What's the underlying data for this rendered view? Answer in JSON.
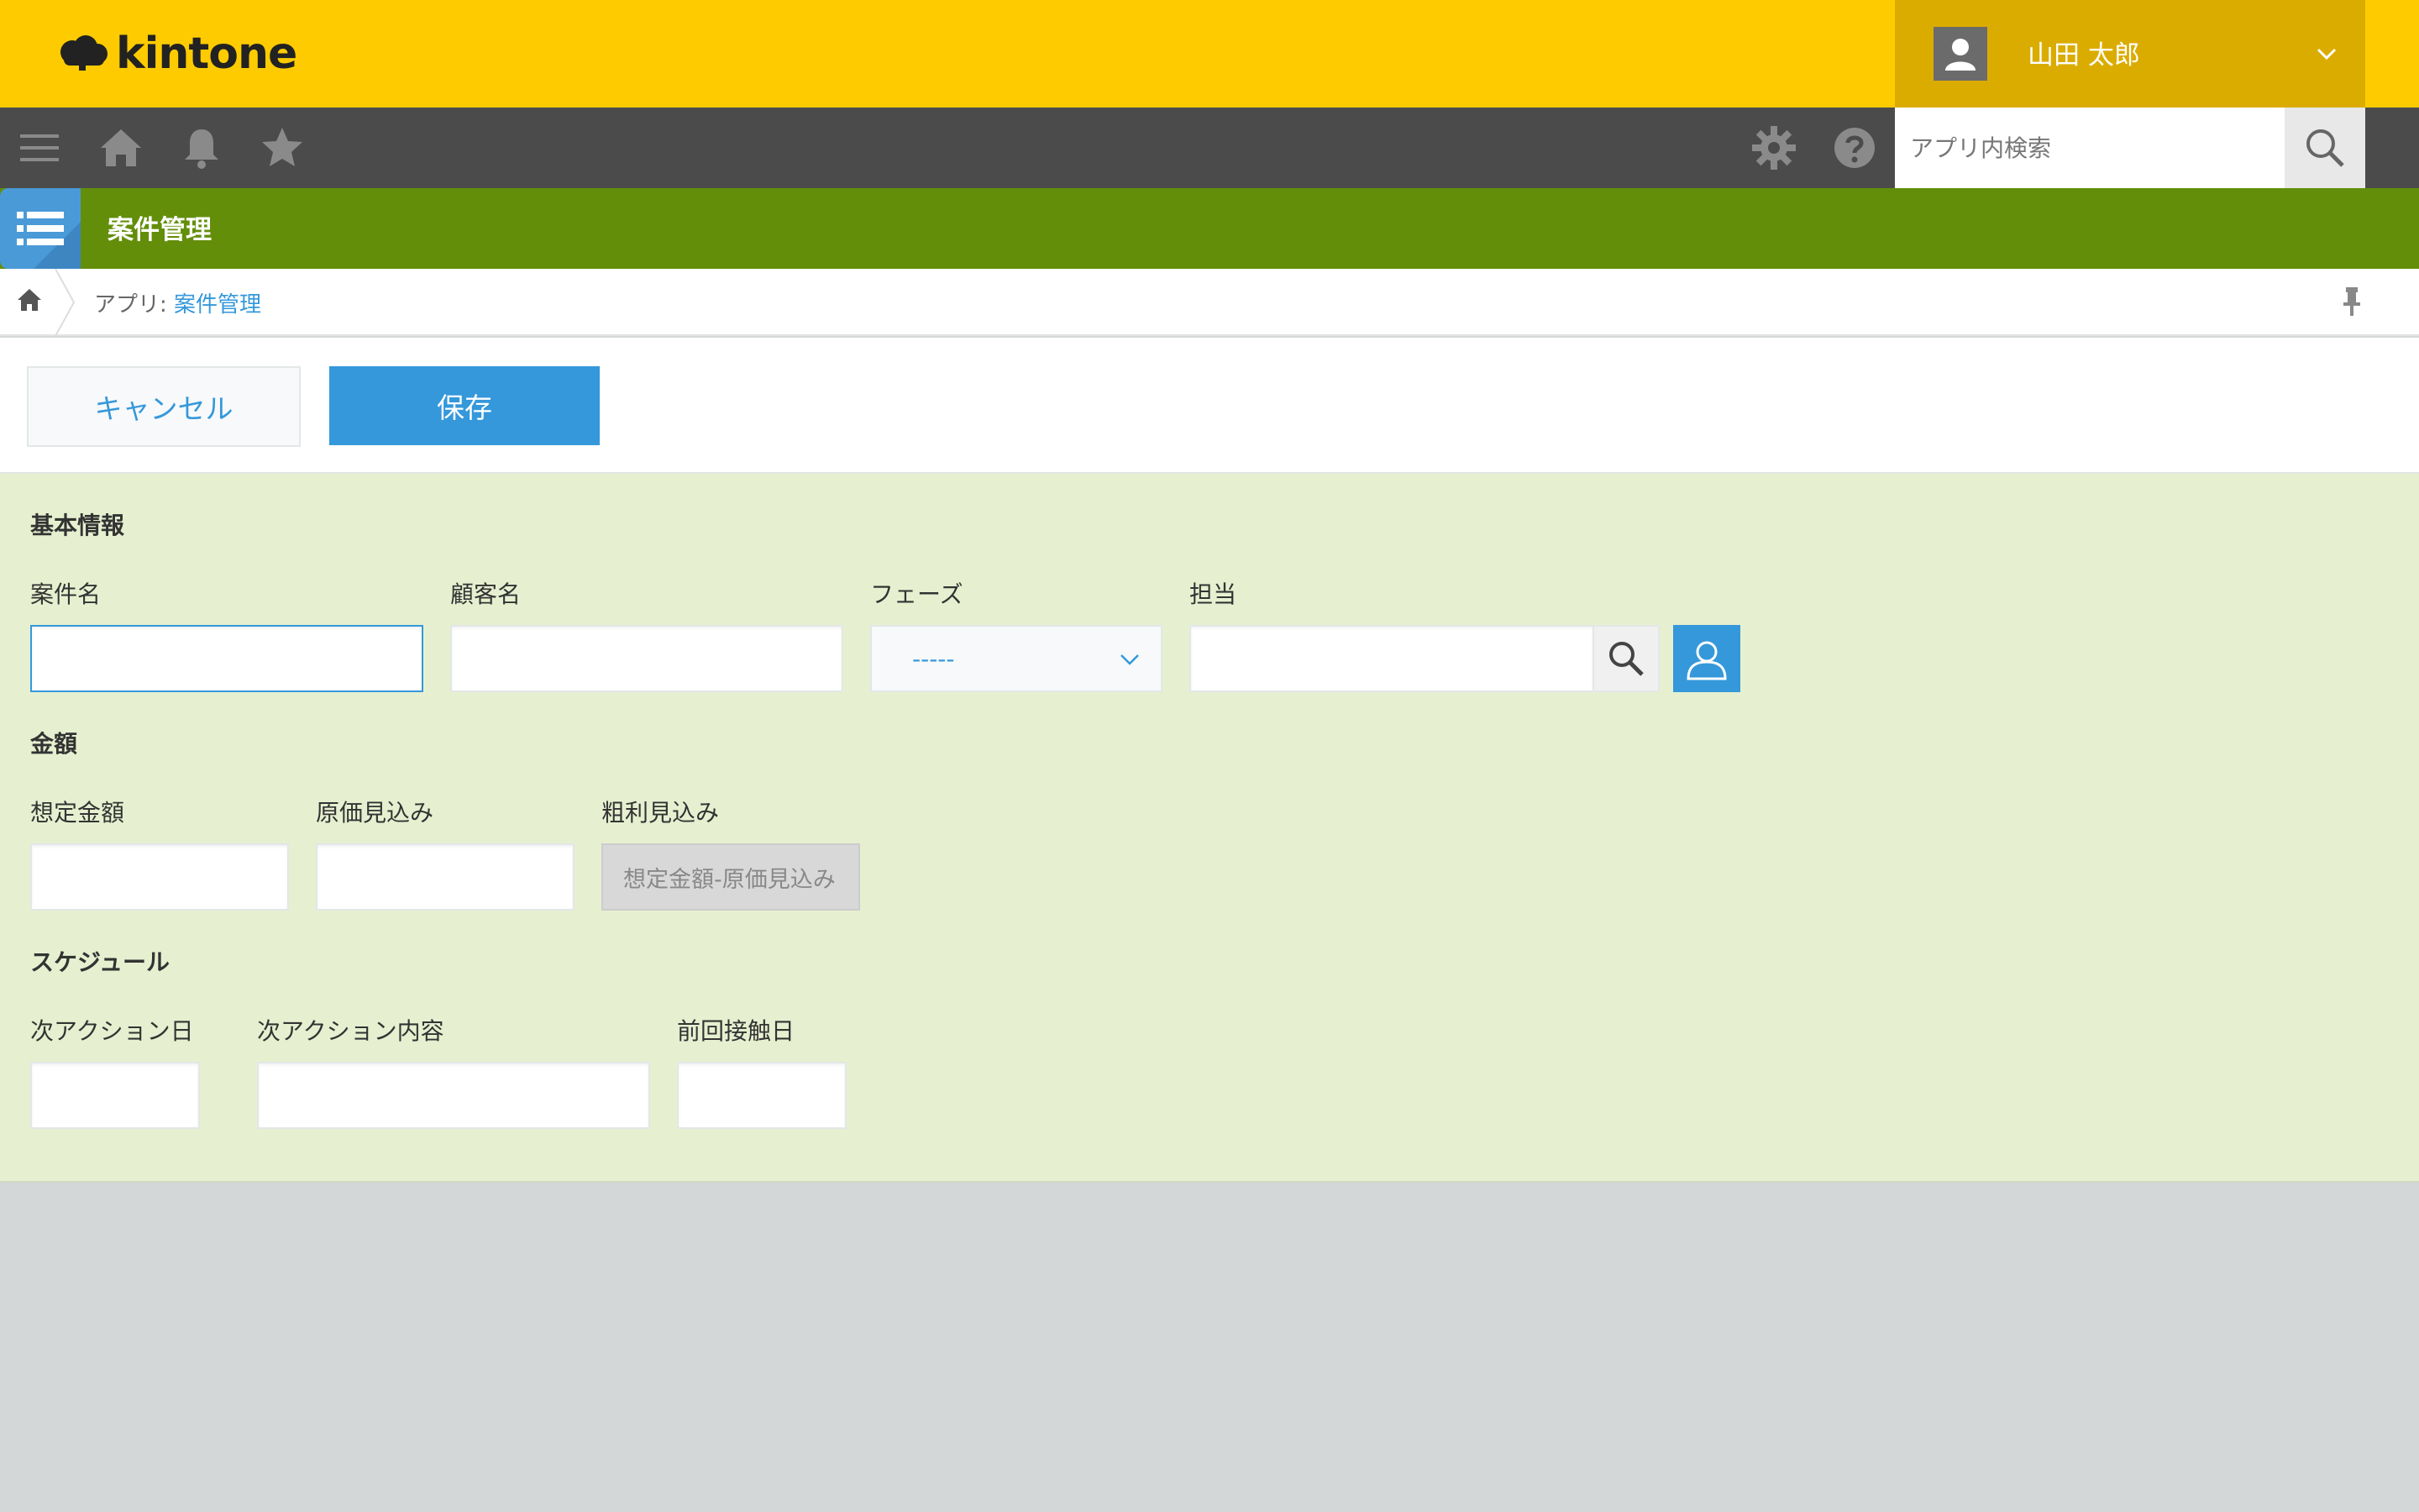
{
  "header": {
    "logo_text": "kintone",
    "user": {
      "name": "山田 太郎"
    }
  },
  "nav": {
    "icons": [
      "menu-icon",
      "home-icon",
      "bell-icon",
      "star-icon",
      "gear-icon",
      "help-icon"
    ],
    "search": {
      "placeholder": "アプリ内検索",
      "value": ""
    }
  },
  "app": {
    "title": "案件管理",
    "accent": "#638e0a"
  },
  "breadcrumb": {
    "prefix": "アプリ: ",
    "app_link": "案件管理"
  },
  "toolbar": {
    "cancel_label": "キャンセル",
    "save_label": "保存"
  },
  "form": {
    "sections": {
      "basic": "基本情報",
      "amount": "金額",
      "schedule": "スケジュール"
    },
    "fields": {
      "deal_name": {
        "label": "案件名",
        "value": ""
      },
      "customer_name": {
        "label": "顧客名",
        "value": ""
      },
      "phase": {
        "label": "フェーズ",
        "value": "-----"
      },
      "owner": {
        "label": "担当",
        "value": ""
      },
      "expected_amount": {
        "label": "想定金額",
        "value": ""
      },
      "expected_cost": {
        "label": "原価見込み",
        "value": ""
      },
      "gross_profit": {
        "label": "粗利見込み",
        "formula": "想定金額-原価見込み"
      },
      "next_action_date": {
        "label": "次アクション日",
        "value": ""
      },
      "next_action_detail": {
        "label": "次アクション内容",
        "value": ""
      },
      "last_contact_date": {
        "label": "前回接触日",
        "value": ""
      }
    }
  },
  "colors": {
    "header_yellow": "#fecb00",
    "user_area": "#dbac00",
    "nav_gray": "#4b4b4b",
    "primary_blue": "#3498db",
    "form_background": "#e6f0d0"
  }
}
